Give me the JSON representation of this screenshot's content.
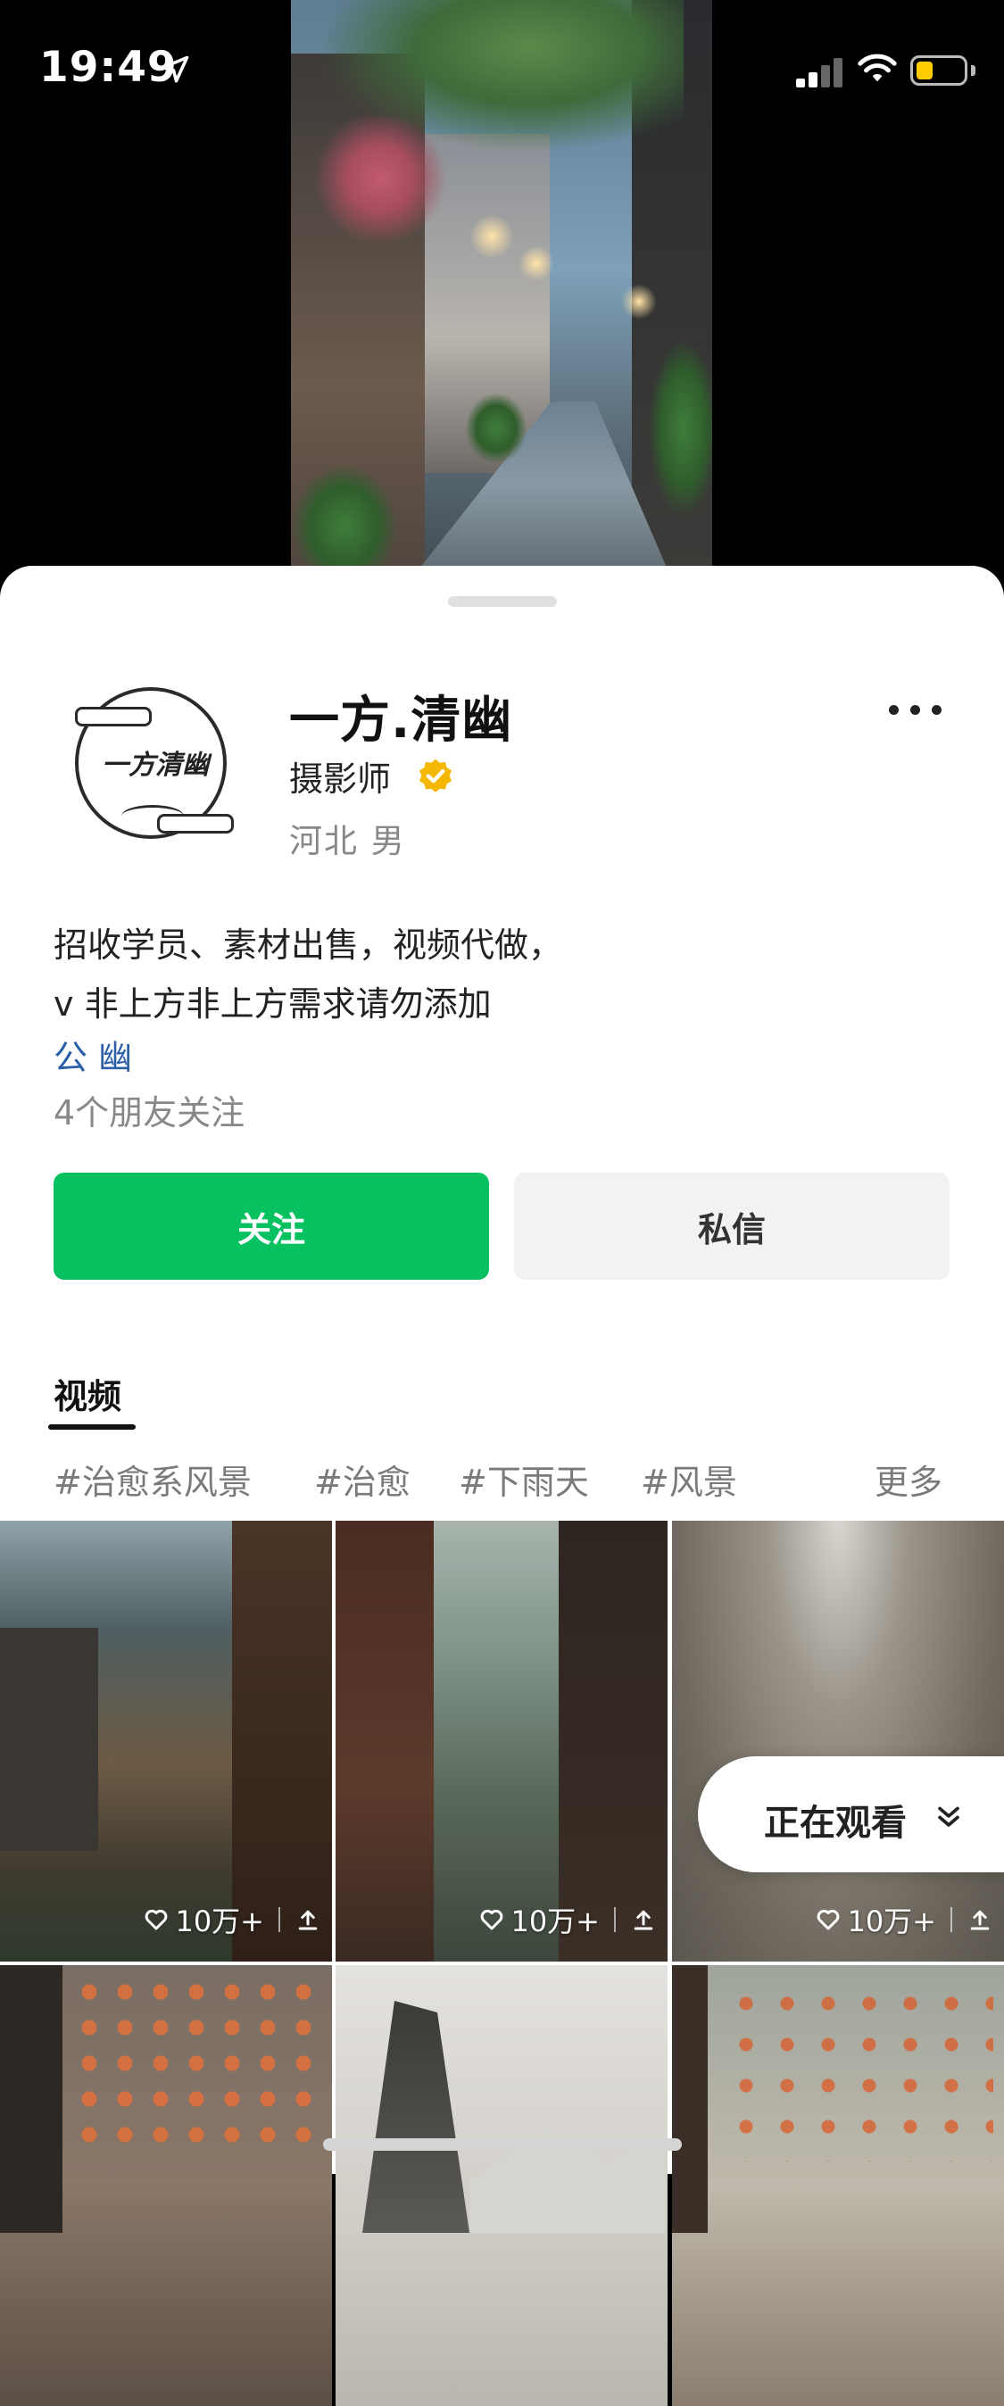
{
  "status_bar": {
    "time": "19:49",
    "icons": [
      "location-arrow-icon",
      "signal-icon",
      "wifi-icon",
      "battery-icon"
    ],
    "battery_color": "#ffcc00"
  },
  "profile": {
    "name": "一方.清幽",
    "avatar_text": "一方清幽",
    "role": "摄影师",
    "region_gender": "河北 男",
    "verified_color": "#f5b800",
    "bio_lines": [
      "招收学员、素材出售，视频代做，",
      "v          非上方非上方需求请勿添加",
      "公                    幽"
    ],
    "friends_following": "4个朋友关注"
  },
  "actions": {
    "follow_label": "关注",
    "message_label": "私信",
    "follow_color": "#07c160"
  },
  "content": {
    "tab_label": "视频",
    "tags": [
      "#治愈系风景",
      "#治愈",
      "#下雨天",
      "#风景"
    ],
    "more_label": "更多",
    "videos": [
      {
        "likes": "10万+",
        "icon": "heart-icon",
        "share_icon": "share-icon"
      },
      {
        "likes": "10万+",
        "icon": "heart-icon",
        "share_icon": "share-icon"
      },
      {
        "likes": "10万+",
        "icon": "heart-icon",
        "share_icon": "share-icon"
      },
      {
        "likes": "",
        "icon": "heart-icon",
        "share_icon": "share-icon"
      },
      {
        "likes": "",
        "icon": "heart-icon",
        "share_icon": "share-icon"
      },
      {
        "likes": "",
        "icon": "heart-icon",
        "share_icon": "share-icon"
      }
    ]
  },
  "floating": {
    "watching_label": "正在观看"
  }
}
